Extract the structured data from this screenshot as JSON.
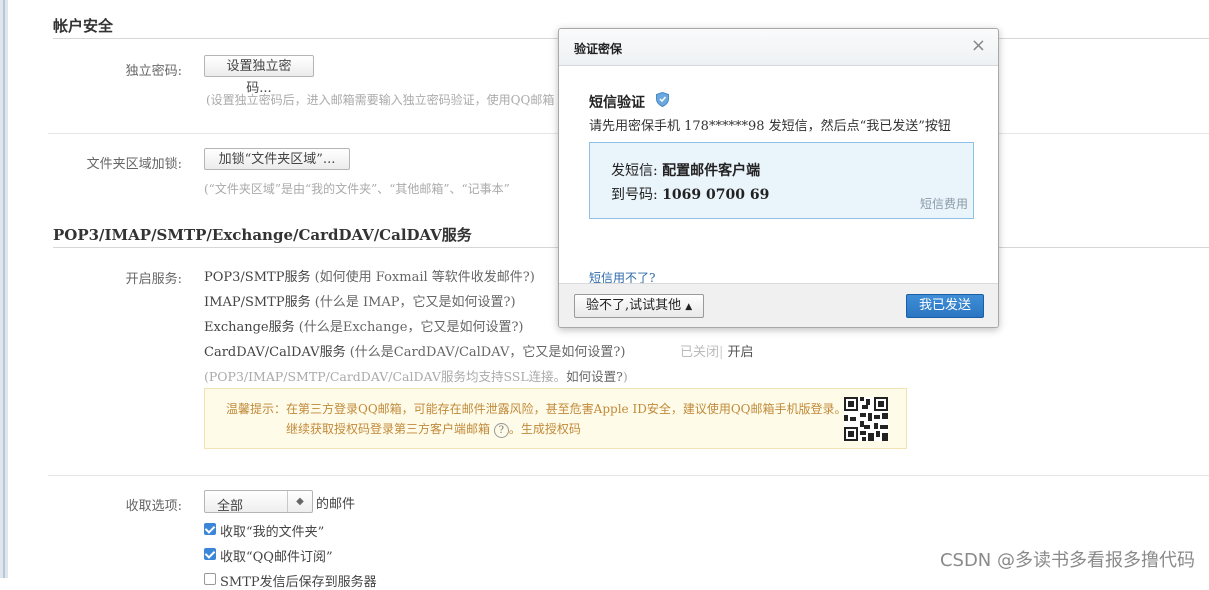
{
  "account_security": {
    "title": "帐户安全",
    "standalone_password": {
      "label": "独立密码:",
      "button": "设置独立密码...",
      "hint": "(设置独立密码后，进入邮箱需要输入独立密码验证，使用QQ邮箱"
    },
    "folder_lock": {
      "label": "文件夹区域加锁:",
      "button": "加锁“文件夹区域”...",
      "hint": "(“文件夹区域”是由“我的文件夹”、“其他邮箱”、“记事本”"
    }
  },
  "services": {
    "title": "POP3/IMAP/SMTP/Exchange/CardDAV/CalDAV服务",
    "label": "开启服务:",
    "items": [
      {
        "name": "POP3/SMTP服务",
        "hint": "(如何使用 Foxmail 等软件收发邮件?)"
      },
      {
        "name": "IMAP/SMTP服务",
        "hint": "(什么是 IMAP，它又是如何设置?)"
      },
      {
        "name": "Exchange服务",
        "hint": "(什么是Exchange，它又是如何设置?)"
      },
      {
        "name": "CardDAV/CalDAV服务",
        "hint": "(什么是CardDAV/CalDAV，它又是如何设置?)"
      }
    ],
    "status_off": "已关闭",
    "status_sep": "|",
    "open_link": "开启",
    "ssl_note": "(POP3/IMAP/SMTP/CardDAV/CalDAV服务均支持SSL连接。",
    "ssl_link": "如何设置?",
    "ssl_close": ")",
    "tip_line1": "温馨提示：在第三方登录QQ邮箱，可能存在邮件泄露风险，甚至危害Apple ID安全，建议使用QQ邮箱手机版登录。",
    "tip_line2": "继续获取授权码登录第三方客户端邮箱",
    "tip_help": "?",
    "tip_line2_end": "。",
    "tip_link": "生成授权码"
  },
  "receive": {
    "label": "收取选项:",
    "select_value": "全部",
    "select_suffix": "的邮件",
    "checkboxes": [
      {
        "label": "收取“我的文件夹”",
        "checked": true
      },
      {
        "label": "收取“QQ邮件订阅”",
        "checked": true
      },
      {
        "label": "SMTP发信后保存到服务器",
        "checked": false
      }
    ]
  },
  "dialog": {
    "title": "验证密保",
    "close": "×",
    "heading": "短信验证",
    "subtitle": "请先用密保手机 178******98 发短信，然后点“我已发送”按钮",
    "send_label": "发短信:",
    "send_value": "配置邮件客户端",
    "to_label": "到号码:",
    "to_value": "1069 0700 69",
    "fee_link": "短信费用",
    "cant_link": "短信用不了?",
    "other_button": "验不了,试试其他",
    "sent_button": "我已发送"
  },
  "watermark": "CSDN @多读书多看报多撸代码",
  "colors": {
    "accent": "#2a75c2",
    "tip_text": "#c08a3a",
    "link": "#1d5b9e"
  }
}
